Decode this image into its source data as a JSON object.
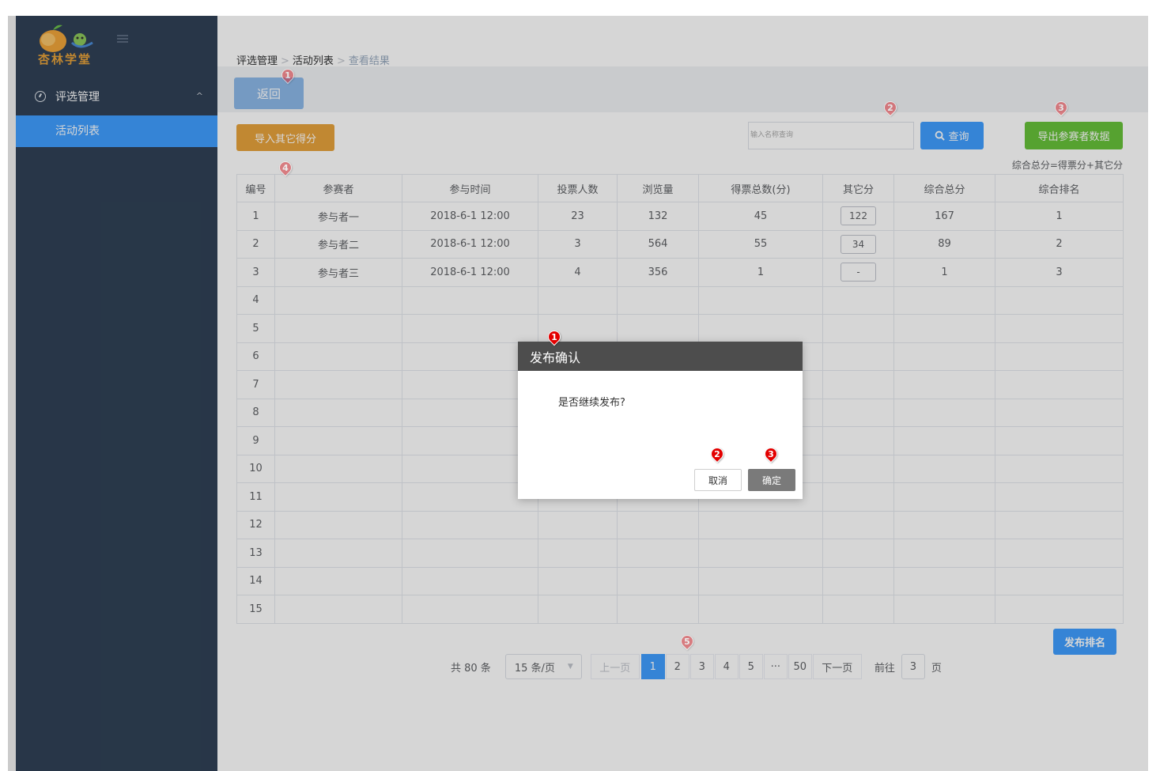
{
  "app": {
    "logo_text": "杏林学堂"
  },
  "sidebar": {
    "group": {
      "label": "评选管理",
      "chevron": "^"
    },
    "items": [
      {
        "label": "活动列表"
      }
    ]
  },
  "breadcrumb": {
    "items": [
      "评选管理",
      "活动列表",
      "查看结果"
    ],
    "separator": ">"
  },
  "toolbar": {
    "back_label": "返回",
    "import_label": "导入其它得分",
    "search_placeholder": "输入名称查询",
    "search_label": "查询",
    "export_label": "导出参赛者数据",
    "formula": "综合总分=得票分+其它分"
  },
  "table": {
    "headers": [
      "编号",
      "参赛者",
      "参与时间",
      "投票人数",
      "浏览量",
      "得票总数(分)",
      "其它分",
      "综合总分",
      "综合排名"
    ],
    "rows": [
      [
        "1",
        "参与者一",
        "2018-6-1   12:00",
        "23",
        "132",
        "45",
        "122",
        "167",
        "1"
      ],
      [
        "2",
        "参与者二",
        "2018-6-1   12:00",
        "3",
        "564",
        "55",
        "34",
        "89",
        "2"
      ],
      [
        "3",
        "参与者三",
        "2018-6-1   12:00",
        "4",
        "356",
        "1",
        "-",
        "1",
        "3"
      ],
      [
        "4",
        "",
        "",
        "",
        "",
        "",
        "",
        "",
        ""
      ],
      [
        "5",
        "",
        "",
        "",
        "",
        "",
        "",
        "",
        ""
      ],
      [
        "6",
        "",
        "",
        "",
        "",
        "",
        "",
        "",
        ""
      ],
      [
        "7",
        "",
        "",
        "",
        "",
        "",
        "",
        "",
        ""
      ],
      [
        "8",
        "",
        "",
        "",
        "",
        "",
        "",
        "",
        ""
      ],
      [
        "9",
        "",
        "",
        "",
        "",
        "",
        "",
        "",
        ""
      ],
      [
        "10",
        "",
        "",
        "",
        "",
        "",
        "",
        "",
        ""
      ],
      [
        "11",
        "",
        "",
        "",
        "",
        "",
        "",
        "",
        ""
      ],
      [
        "12",
        "",
        "",
        "",
        "",
        "",
        "",
        "",
        ""
      ],
      [
        "13",
        "",
        "",
        "",
        "",
        "",
        "",
        "",
        ""
      ],
      [
        "14",
        "",
        "",
        "",
        "",
        "",
        "",
        "",
        ""
      ],
      [
        "15",
        "",
        "",
        "",
        "",
        "",
        "",
        "",
        ""
      ]
    ]
  },
  "publish_label": "发布排名",
  "pagination": {
    "total": "共 80 条",
    "page_size": "15 条/页",
    "prev": "上一页",
    "pages": [
      "1",
      "2",
      "3",
      "4",
      "5",
      "···",
      "50"
    ],
    "active_page": "1",
    "next": "下一页",
    "goto_label": "前往",
    "goto_value": "3",
    "page_suffix": "页"
  },
  "dialog": {
    "title": "发布确认",
    "message": "是否继续发布?",
    "cancel_label": "取消",
    "ok_label": "确定"
  },
  "markers": {
    "page": [
      "1",
      "2",
      "3",
      "4",
      "5"
    ],
    "dialog": [
      "1",
      "2",
      "3"
    ]
  },
  "colors": {
    "sidebar": "#304156",
    "primary": "#409eff",
    "warning": "#e6a23c",
    "success": "#67c23a",
    "marker": "#d9343a",
    "dialog_header": "#4d4d4d"
  }
}
